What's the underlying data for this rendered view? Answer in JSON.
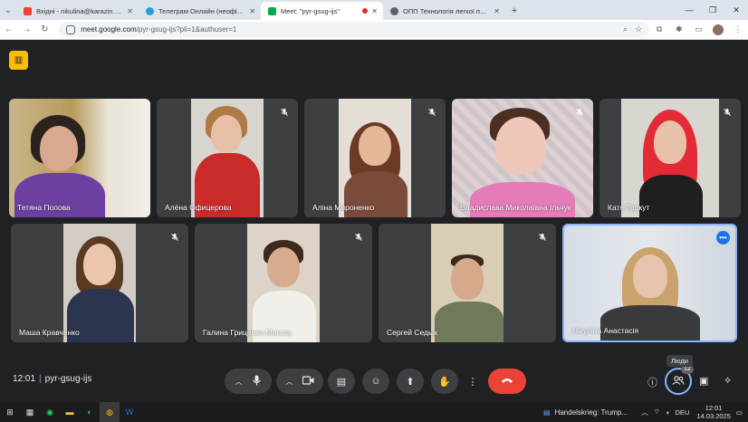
{
  "browser": {
    "tabs": [
      {
        "title": "Вхідні - nikulina@karazin.ua - ...",
        "favicon": "gmail-icon",
        "color": "#ea4335",
        "active": false
      },
      {
        "title": "Телеграм Онлайн (неофіційн...",
        "favicon": "telegram-icon",
        "color": "#229ed9",
        "active": false
      },
      {
        "title": "Meet: \"pyr-gsug-ijs\"",
        "favicon": "meet-icon",
        "color": "#00ac47",
        "active": true
      },
      {
        "title": "ОПП Технологія легкої промис...",
        "favicon": "site-icon",
        "color": "#5f6368",
        "active": false
      }
    ],
    "url_host": "meet.google.com",
    "url_path": "/pyr-gsug-ijs?pli=1&authuser=1"
  },
  "meeting": {
    "time": "12:01",
    "code": "pyr-gsug-ijs",
    "people_count": "12",
    "tooltip": "Люди"
  },
  "participants": [
    {
      "name": "Тетяна Попова",
      "muted": false
    },
    {
      "name": "Алёна Офицерова",
      "muted": true
    },
    {
      "name": "Аліна Мироненко",
      "muted": true
    },
    {
      "name": "Владислава Миколаївна Ільчук",
      "muted": true
    },
    {
      "name": "Катя Торкут",
      "muted": true
    },
    {
      "name": "Маша Кравченко",
      "muted": true
    },
    {
      "name": "Галина Гриценко-Мигаль",
      "muted": true
    },
    {
      "name": "Сергей Седых",
      "muted": true
    },
    {
      "name": "Нікуліна Анастасія",
      "muted": false
    }
  ],
  "taskbar": {
    "news": "Handelskrieg: Trump...",
    "lang": "DEU",
    "time": "12:01",
    "date": "14.03.2025"
  },
  "colors": {
    "meet_bg": "#202124",
    "tile_bg": "#3c4043",
    "end_call": "#ea4335",
    "accent": "#8ab4f8"
  }
}
